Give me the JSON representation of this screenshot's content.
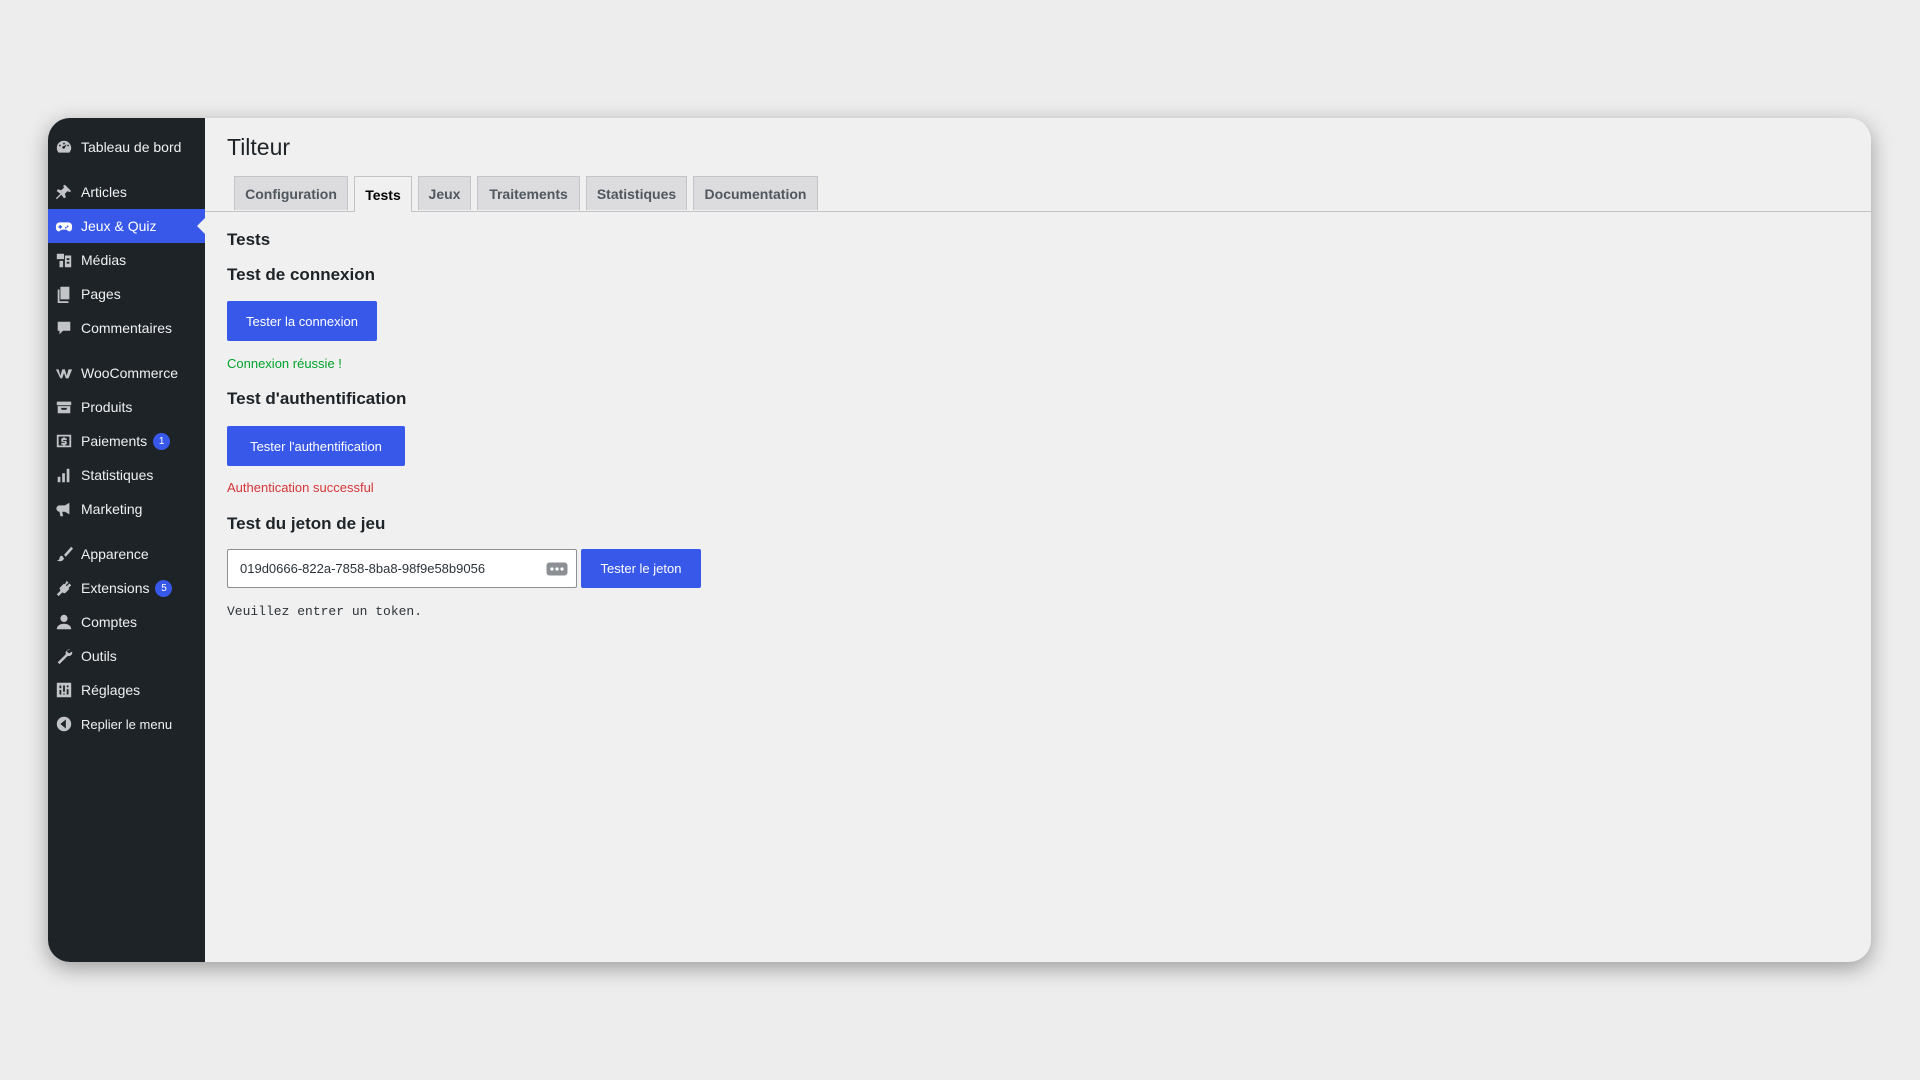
{
  "sidebar": {
    "items": [
      {
        "label": "Tableau de bord",
        "icon": "dashboard-icon"
      },
      {
        "label": "Articles",
        "icon": "pin-icon"
      },
      {
        "label": "Jeux & Quiz",
        "icon": "gamepad-icon",
        "active": true
      },
      {
        "label": "Médias",
        "icon": "media-icon"
      },
      {
        "label": "Pages",
        "icon": "pages-icon"
      },
      {
        "label": "Commentaires",
        "icon": "comment-icon"
      },
      {
        "label": "WooCommerce",
        "icon": "woocommerce-icon"
      },
      {
        "label": "Produits",
        "icon": "archive-icon"
      },
      {
        "label": "Paiements",
        "icon": "dollar-icon",
        "badge": "1"
      },
      {
        "label": "Statistiques",
        "icon": "bar-chart-icon"
      },
      {
        "label": "Marketing",
        "icon": "megaphone-icon"
      },
      {
        "label": "Apparence",
        "icon": "paintbrush-icon"
      },
      {
        "label": "Extensions",
        "icon": "plugin-icon",
        "badge": "5"
      },
      {
        "label": "Comptes",
        "icon": "user-icon"
      },
      {
        "label": "Outils",
        "icon": "wrench-icon"
      },
      {
        "label": "Réglages",
        "icon": "settings-icon"
      },
      {
        "label": "Replier le menu",
        "icon": "collapse-arrow-icon"
      }
    ]
  },
  "page": {
    "title": "Tilteur",
    "tabs": [
      "Configuration",
      "Tests",
      "Jeux",
      "Traitements",
      "Statistiques",
      "Documentation"
    ],
    "active_tab": "Tests"
  },
  "tests": {
    "heading": "Tests",
    "connection": {
      "heading": "Test de connexion",
      "button": "Tester la connexion",
      "status": "Connexion réussie !"
    },
    "auth": {
      "heading": "Test d'authentification",
      "button": "Tester l'authentification",
      "status": "Authentication successful"
    },
    "token": {
      "heading": "Test du jeton de jeu",
      "value": "019d0666-822a-7858-8ba8-98f9e58b9056",
      "button": "Tester le jeton",
      "message": "Veuillez entrer un token."
    }
  },
  "colors": {
    "accent": "#3858e9",
    "sidebar": "#1d2327",
    "success": "#00a32a",
    "error": "#d63638"
  }
}
